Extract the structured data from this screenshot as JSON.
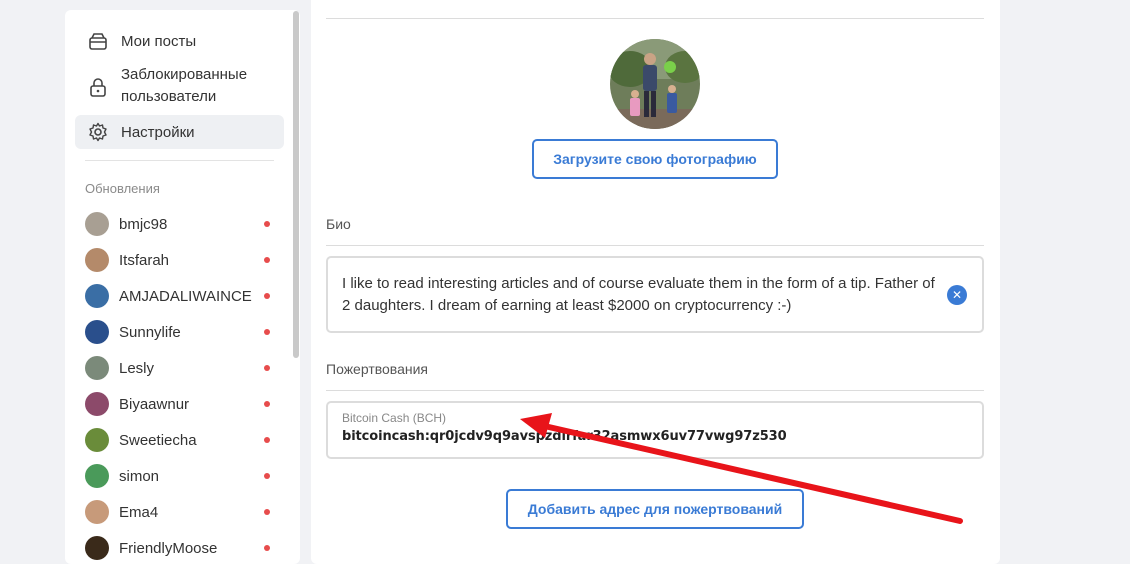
{
  "sidebar": {
    "nav": [
      {
        "label": "Мои посты",
        "icon": "inbox-icon"
      },
      {
        "label": "Заблокированные пользователи",
        "icon": "lock-icon"
      },
      {
        "label": "Настройки",
        "icon": "gear-icon"
      }
    ],
    "updates_label": "Обновления",
    "updates": [
      {
        "name": "bmjc98",
        "avatar_color": "#a89f93"
      },
      {
        "name": "Itsfarah",
        "avatar_color": "#b48a6a"
      },
      {
        "name": "AMJADALIWAINCE",
        "avatar_color": "#3a6ea5"
      },
      {
        "name": "Sunnylife",
        "avatar_color": "#2a4f8c"
      },
      {
        "name": "Lesly",
        "avatar_color": "#7b8a7a"
      },
      {
        "name": "Biyaawnur",
        "avatar_color": "#8c4a6a"
      },
      {
        "name": "Sweetiecha",
        "avatar_color": "#6a8c3a"
      },
      {
        "name": "simon",
        "avatar_color": "#4a9a5a"
      },
      {
        "name": "Ema4",
        "avatar_color": "#c79a7a"
      },
      {
        "name": "FriendlyMoose",
        "avatar_color": "#3a2a1a"
      }
    ]
  },
  "main": {
    "upload_button": "Загрузите свою фотографию",
    "bio_label": "Био",
    "bio_text": "I like to read interesting articles and of course evaluate them in the form of a tip. Father of 2 daughters. I dream of earning at least $2000 on cryptocurrency :-)",
    "donations_label": "Пожертвования",
    "donation": {
      "type": "Bitcoin Cash (BCH)",
      "address": "bitcoincash:qr0jcdv9q9avspzdlrfar32asmwx6uv77vwg97z530"
    },
    "add_donation_button": "Добавить адрес для пожертвований"
  },
  "colors": {
    "accent": "#3a7bd5",
    "arrow": "#e8141a",
    "notification_dot": "#e74c4c"
  }
}
